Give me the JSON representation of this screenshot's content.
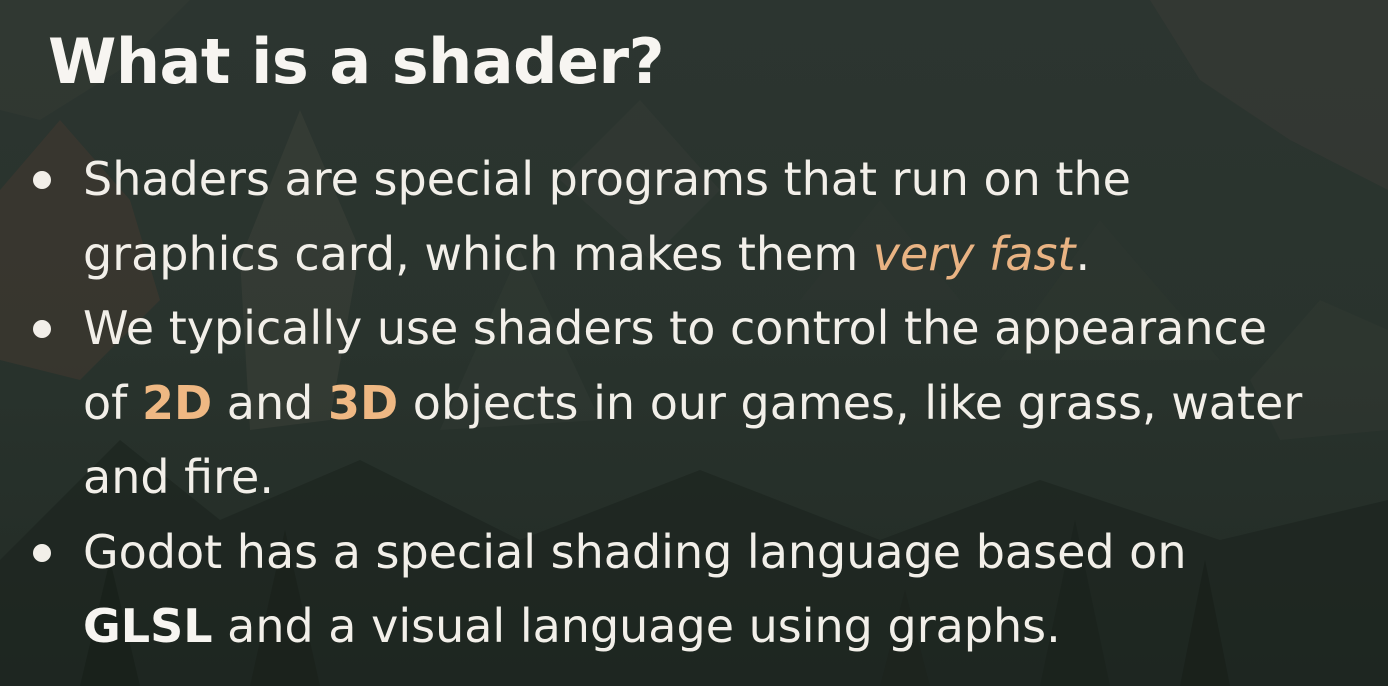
{
  "title": "What is a shader?",
  "bullets": [
    {
      "parts": [
        "Shaders are special programs that run on the graphics card, which makes them ",
        "very fast",
        "."
      ]
    },
    {
      "parts": [
        "We typically use shaders to control the appearance of ",
        "2D",
        " and ",
        "3D",
        " objects in our games, like grass, water and fire."
      ]
    },
    {
      "parts": [
        "Godot has a special shading language based on ",
        "GLSL",
        " and a visual language using graphs."
      ]
    }
  ],
  "colors": {
    "background": "#26302a",
    "text": "#f2efe9",
    "accent": "#e9b383"
  }
}
